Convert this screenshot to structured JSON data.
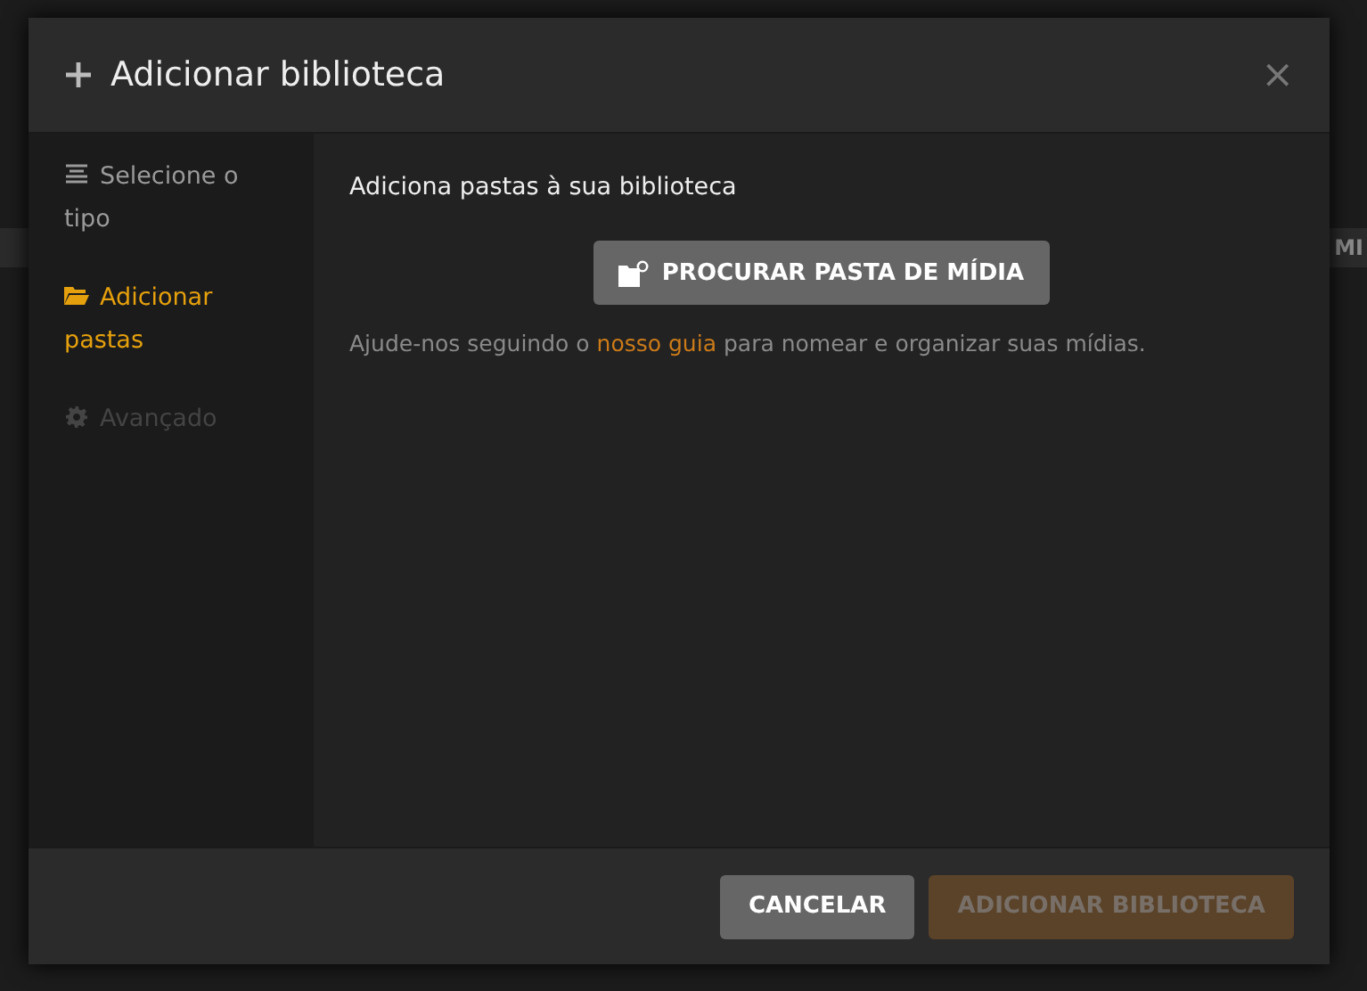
{
  "background": {
    "tab_label": "MI"
  },
  "dialog": {
    "title": "Adicionar biblioteca",
    "close": "×",
    "steps": [
      {
        "label": "Selecione o tipo",
        "kind": "list",
        "selected": false,
        "disabled": false
      },
      {
        "label": "Adicionar pastas",
        "kind": "folder",
        "selected": true,
        "disabled": false
      },
      {
        "label": "Avançado",
        "kind": "gear",
        "selected": false,
        "disabled": true
      }
    ],
    "heading": "Adiciona pastas à sua biblioteca",
    "browse_button": "PROCURAR PASTA DE MÍDIA",
    "help": {
      "before": "Ajude-nos seguindo o",
      "link": "nosso guia",
      "after": "para nomear e organizar suas mídias."
    },
    "buttons": [
      {
        "label": "CANCELAR",
        "kind": "secondary",
        "disabled": false
      },
      {
        "label": "ADICIONAR BIBLIOTECA",
        "kind": "primary",
        "disabled": true
      }
    ]
  }
}
